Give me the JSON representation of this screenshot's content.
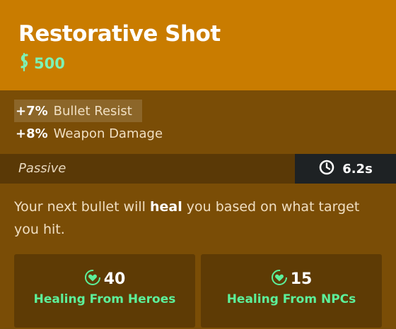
{
  "item": {
    "title": "Restorative Shot",
    "price": "500"
  },
  "stats": [
    {
      "value": "+7%",
      "label": "Bullet Resist"
    },
    {
      "value": "+8%",
      "label": "Weapon Damage"
    }
  ],
  "passive": {
    "label": "Passive",
    "cooldown": "6.2s"
  },
  "description": {
    "before": "Your next bullet will ",
    "highlight": "heal",
    "after": " you based on what target you hit."
  },
  "boxes": [
    {
      "value": "40",
      "label": "Healing From Heroes",
      "icon": "heart-heal-icon"
    },
    {
      "value": "15",
      "label": "Healing From NPCs",
      "icon": "heart-heal-icon"
    }
  ],
  "colors": {
    "header": "#c97c00",
    "body": "#7a4d06",
    "price": "#7df2b4",
    "heal": "#5cf09a"
  }
}
